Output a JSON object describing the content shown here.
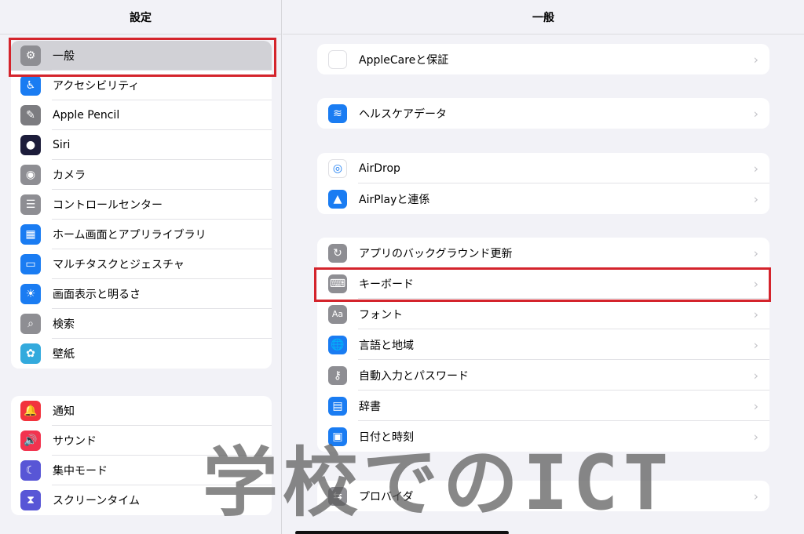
{
  "sidebar": {
    "title": "設定",
    "group1": [
      {
        "label": "一般",
        "icon": "gear-icon",
        "color": "#8e8e93"
      },
      {
        "label": "アクセシビリティ",
        "icon": "accessibility-icon",
        "color": "#1a7cf2"
      },
      {
        "label": "Apple Pencil",
        "icon": "pencil-icon",
        "color": "#7c7c80"
      },
      {
        "label": "Siri",
        "icon": "siri-icon",
        "color": "#1c1c3a"
      },
      {
        "label": "カメラ",
        "icon": "camera-icon",
        "color": "#8e8e93"
      },
      {
        "label": "コントロールセンター",
        "icon": "control-center-icon",
        "color": "#8e8e93"
      },
      {
        "label": "ホーム画面とアプリライブラリ",
        "icon": "home-screen-icon",
        "color": "#1a7cf2"
      },
      {
        "label": "マルチタスクとジェスチャ",
        "icon": "multitask-icon",
        "color": "#1a7cf2"
      },
      {
        "label": "画面表示と明るさ",
        "icon": "brightness-icon",
        "color": "#1a7cf2"
      },
      {
        "label": "検索",
        "icon": "search-icon",
        "color": "#8e8e93"
      },
      {
        "label": "壁紙",
        "icon": "wallpaper-icon",
        "color": "#33aadd"
      }
    ],
    "group2": [
      {
        "label": "通知",
        "icon": "notification-icon",
        "color": "#f2333d"
      },
      {
        "label": "サウンド",
        "icon": "sound-icon",
        "color": "#f2334f"
      },
      {
        "label": "集中モード",
        "icon": "focus-moon-icon",
        "color": "#5856d6"
      },
      {
        "label": "スクリーンタイム",
        "icon": "hourglass-icon",
        "color": "#5856d6"
      }
    ]
  },
  "main": {
    "title": "一般",
    "groups": [
      [
        {
          "label": "AppleCareと保証",
          "icon": "apple-logo-icon",
          "color": "#ffffff"
        }
      ],
      [
        {
          "label": "ヘルスケアデータ",
          "icon": "health-data-icon",
          "color": "#1a7cf2"
        }
      ],
      [
        {
          "label": "AirDrop",
          "icon": "airdrop-icon",
          "color": "#ffffff"
        },
        {
          "label": "AirPlayと連係",
          "icon": "airplay-icon",
          "color": "#1a7cf2"
        }
      ],
      [
        {
          "label": "アプリのバックグラウンド更新",
          "icon": "background-refresh-icon",
          "color": "#8e8e93"
        },
        {
          "label": "キーボード",
          "icon": "keyboard-icon",
          "color": "#8e8e93"
        },
        {
          "label": "フォント",
          "icon": "font-icon",
          "color": "#8e8e93"
        },
        {
          "label": "言語と地域",
          "icon": "globe-icon",
          "color": "#1a7cf2"
        },
        {
          "label": "自動入力とパスワード",
          "icon": "key-icon",
          "color": "#8e8e93"
        },
        {
          "label": "辞書",
          "icon": "dictionary-icon",
          "color": "#1a7cf2"
        },
        {
          "label": "日付と時刻",
          "icon": "calendar-clock-icon",
          "color": "#1a7cf2"
        }
      ],
      [
        {
          "label": "VPNとデバイス管理",
          "icon": "vpn-icon",
          "color": "#8e8e93"
        },
        {
          "label": "プロバイダ",
          "icon": "provider-icon",
          "color": "#8e8e93"
        }
      ]
    ]
  },
  "watermark": "学校でのICT",
  "colors": {
    "highlight": "#d4242c",
    "background": "#f2f2f7"
  }
}
